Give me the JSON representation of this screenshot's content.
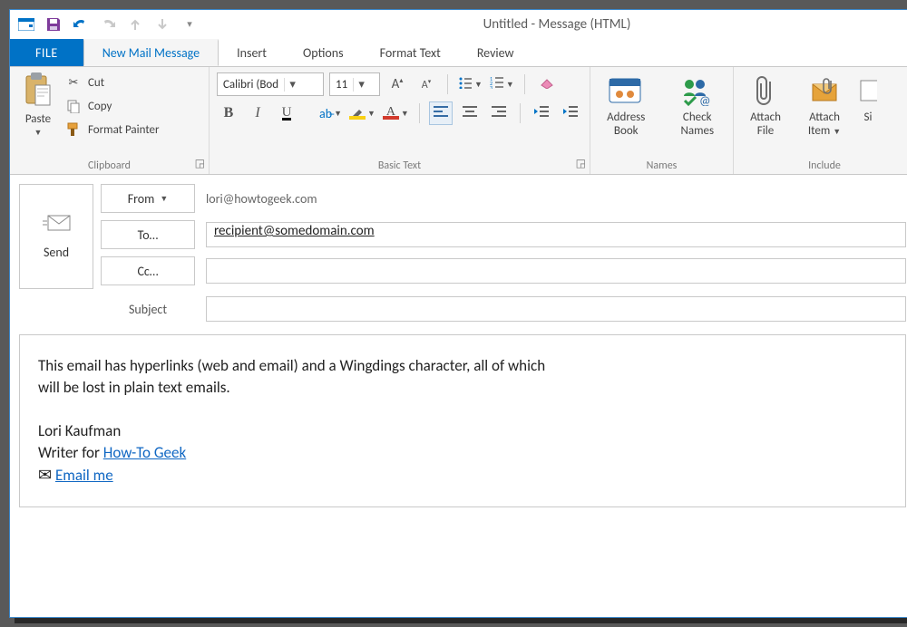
{
  "window": {
    "title": "Untitled - Message (HTML)"
  },
  "qat": {
    "icons": [
      "window-icon",
      "save-icon",
      "undo-icon",
      "redo-icon",
      "prev-icon",
      "next-icon",
      "more-icon"
    ]
  },
  "tabs": {
    "file": "FILE",
    "items": [
      "New Mail Message",
      "Insert",
      "Options",
      "Format Text",
      "Review"
    ],
    "active": 0
  },
  "ribbon": {
    "clipboard": {
      "label": "Clipboard",
      "paste": "Paste",
      "cut": "Cut",
      "copy": "Copy",
      "formatpainter": "Format Painter"
    },
    "basictext": {
      "label": "Basic Text",
      "font": "Calibri (Bod",
      "size": "11"
    },
    "names": {
      "label": "Names",
      "addressbook": "Address\nBook",
      "checknames": "Check\nNames"
    },
    "include": {
      "label": "Include",
      "attachfile": "Attach\nFile",
      "attachitem": "Attach\nItem",
      "sig": "Si"
    }
  },
  "compose": {
    "send": "Send",
    "frombtn": "From",
    "fromval": "lori@howtogeek.com",
    "tobtn": "To…",
    "toval": "recipient@somedomain.com",
    "ccbtn": "Cc…",
    "ccval": "",
    "subjectlabel": "Subject",
    "subjectval": ""
  },
  "body": {
    "line1": "This email has hyperlinks (web and email) and a Wingdings character, all of which",
    "line2": "will be lost in plain text emails.",
    "sig_name": "Lori Kaufman",
    "sig_writer": "Writer for ",
    "sig_link": "How-To Geek",
    "sig_email": "Email me"
  }
}
